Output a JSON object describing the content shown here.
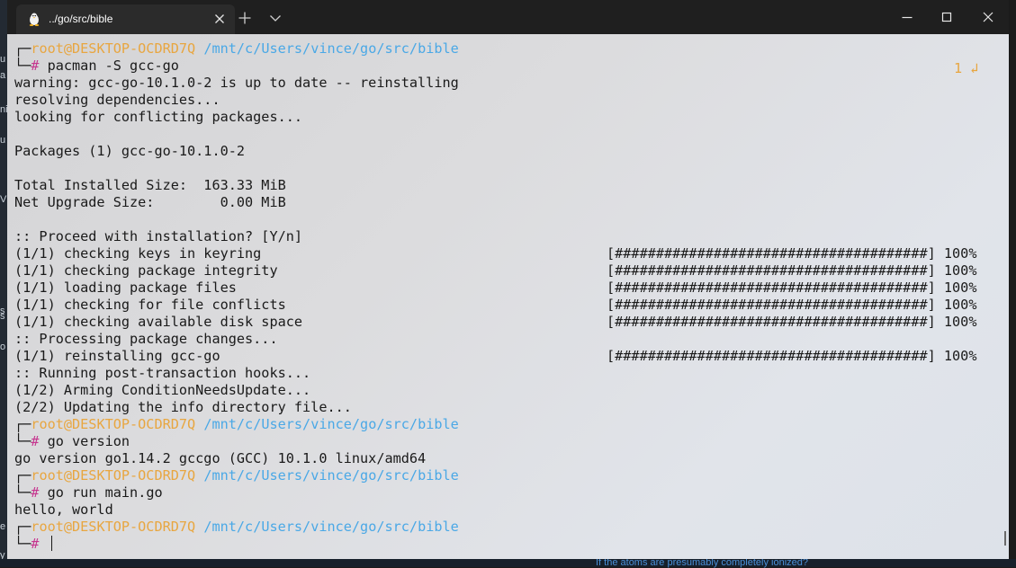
{
  "window": {
    "tab_title": "../go/src/bible",
    "tab_icon": "linux-penguin-icon"
  },
  "background": {
    "left_chars": [
      "u",
      "a",
      "ni",
      "u",
      "V",
      "s",
      "s",
      "o",
      "e",
      "y"
    ],
    "bottom_link": "If the atoms are presumably completely ionized?"
  },
  "terminal": {
    "prompt": {
      "user": "root@DESKTOP-OCDRD7Q",
      "path": "/mnt/c/Users/vince/go/src/bible",
      "hash": "#"
    },
    "right_indicator": "1 ↲",
    "lines": [
      {
        "type": "prompt-top"
      },
      {
        "type": "prompt-cmd",
        "text": "pacman -S gcc-go"
      },
      {
        "type": "out",
        "text": "warning: gcc-go-10.1.0-2 is up to date -- reinstalling"
      },
      {
        "type": "out",
        "text": "resolving dependencies..."
      },
      {
        "type": "out",
        "text": "looking for conflicting packages..."
      },
      {
        "type": "out",
        "text": ""
      },
      {
        "type": "out",
        "text": "Packages (1) gcc-go-10.1.0-2"
      },
      {
        "type": "out",
        "text": ""
      },
      {
        "type": "out",
        "text": "Total Installed Size:  163.33 MiB"
      },
      {
        "type": "out",
        "text": "Net Upgrade Size:        0.00 MiB"
      },
      {
        "type": "out",
        "text": ""
      },
      {
        "type": "out",
        "text": ":: Proceed with installation? [Y/n]"
      },
      {
        "type": "out",
        "text": "(1/1) checking keys in keyring",
        "progress": "[######################################] 100%"
      },
      {
        "type": "out",
        "text": "(1/1) checking package integrity",
        "progress": "[######################################] 100%"
      },
      {
        "type": "out",
        "text": "(1/1) loading package files",
        "progress": "[######################################] 100%"
      },
      {
        "type": "out",
        "text": "(1/1) checking for file conflicts",
        "progress": "[######################################] 100%"
      },
      {
        "type": "out",
        "text": "(1/1) checking available disk space",
        "progress": "[######################################] 100%"
      },
      {
        "type": "out",
        "text": ":: Processing package changes..."
      },
      {
        "type": "out",
        "text": "(1/1) reinstalling gcc-go",
        "progress": "[######################################] 100%"
      },
      {
        "type": "out",
        "text": ":: Running post-transaction hooks..."
      },
      {
        "type": "out",
        "text": "(1/2) Arming ConditionNeedsUpdate..."
      },
      {
        "type": "out",
        "text": "(2/2) Updating the info directory file..."
      },
      {
        "type": "prompt-top"
      },
      {
        "type": "prompt-cmd",
        "text": "go version"
      },
      {
        "type": "out",
        "text": "go version go1.14.2 gccgo (GCC) 10.1.0 linux/amd64"
      },
      {
        "type": "prompt-top"
      },
      {
        "type": "prompt-cmd",
        "text": "go run main.go"
      },
      {
        "type": "out",
        "text": "hello, world"
      },
      {
        "type": "prompt-top"
      },
      {
        "type": "prompt-cmd",
        "text": "",
        "cursor": true
      }
    ]
  }
}
